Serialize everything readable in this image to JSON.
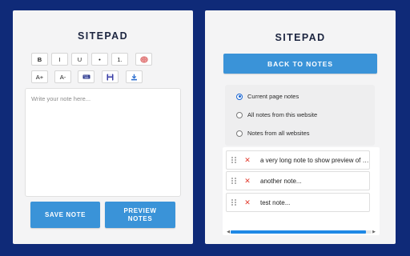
{
  "editor": {
    "title": "SITEPAD",
    "toolbar": {
      "bold": "B",
      "italic": "I",
      "underline": "U",
      "bullet": "•",
      "numbered": "1.",
      "font_increase": "A+",
      "font_decrease": "A-"
    },
    "note_placeholder": "Write your note here...",
    "save_label": "SAVE NOTE",
    "preview_label": "PREVIEW NOTES"
  },
  "notes_view": {
    "title": "SITEPAD",
    "back_label": "BACK TO NOTES",
    "scope_options": [
      {
        "label": "Current page notes",
        "checked": true
      },
      {
        "label": "All notes from this website",
        "checked": false
      },
      {
        "label": "Notes from all websites",
        "checked": false
      }
    ],
    "notes": [
      {
        "text": "a very long note to show preview of the note"
      },
      {
        "text": "another note..."
      },
      {
        "text": "test note..."
      }
    ]
  },
  "colors": {
    "background": "#0f2a78",
    "accent": "#3a93d8",
    "delete": "#e23b2e"
  },
  "icons": {
    "tool_6": "brain-icon",
    "tool_9": "keyboard-icon",
    "tool_10": "floppy-disk-icon",
    "tool_11": "download-icon"
  }
}
